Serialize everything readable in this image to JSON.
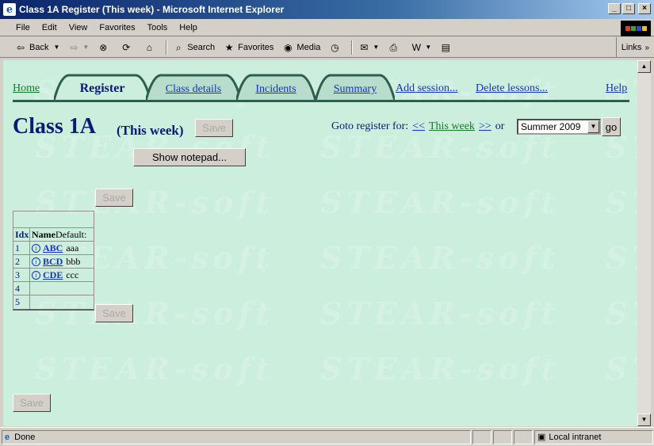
{
  "window": {
    "title": "Class 1A Register (This week) - Microsoft Internet Explorer"
  },
  "menu": [
    "File",
    "Edit",
    "View",
    "Favorites",
    "Tools",
    "Help"
  ],
  "toolbar": {
    "back": "Back",
    "search": "Search",
    "favorites": "Favorites",
    "media": "Media",
    "links": "Links"
  },
  "nav": {
    "home": "Home",
    "register": "Register",
    "class_details": "Class details",
    "incidents": "Incidents",
    "summary": "Summary",
    "add_session": "Add session...",
    "delete_lessons": "Delete lessons...",
    "help": "Help"
  },
  "page": {
    "title": "Class 1A",
    "subtitle": "(This week)",
    "save_label": "Save",
    "show_notepad": "Show notepad...",
    "goto_label": "Goto register for:",
    "prev": "<<",
    "this_week": "This week",
    "next": ">>",
    "or": "or",
    "term_selected": "Summer 2009",
    "go": "go",
    "watermark": "STEAR-soft"
  },
  "table": {
    "headers": {
      "idx": "Idx",
      "name": "Name",
      "default": "Default:"
    },
    "rows": [
      {
        "idx": "1",
        "name": "ABC",
        "default": "aaa"
      },
      {
        "idx": "2",
        "name": "BCD",
        "default": "bbb"
      },
      {
        "idx": "3",
        "name": "CDE",
        "default": "ccc"
      },
      {
        "idx": "4",
        "name": "",
        "default": ""
      },
      {
        "idx": "5",
        "name": "",
        "default": ""
      }
    ]
  },
  "status": {
    "text": "Done",
    "zone": "Local intranet"
  },
  "colors": {
    "page_bg": "#cceedd",
    "heading": "#0a1a78",
    "link": "#1533c8"
  }
}
